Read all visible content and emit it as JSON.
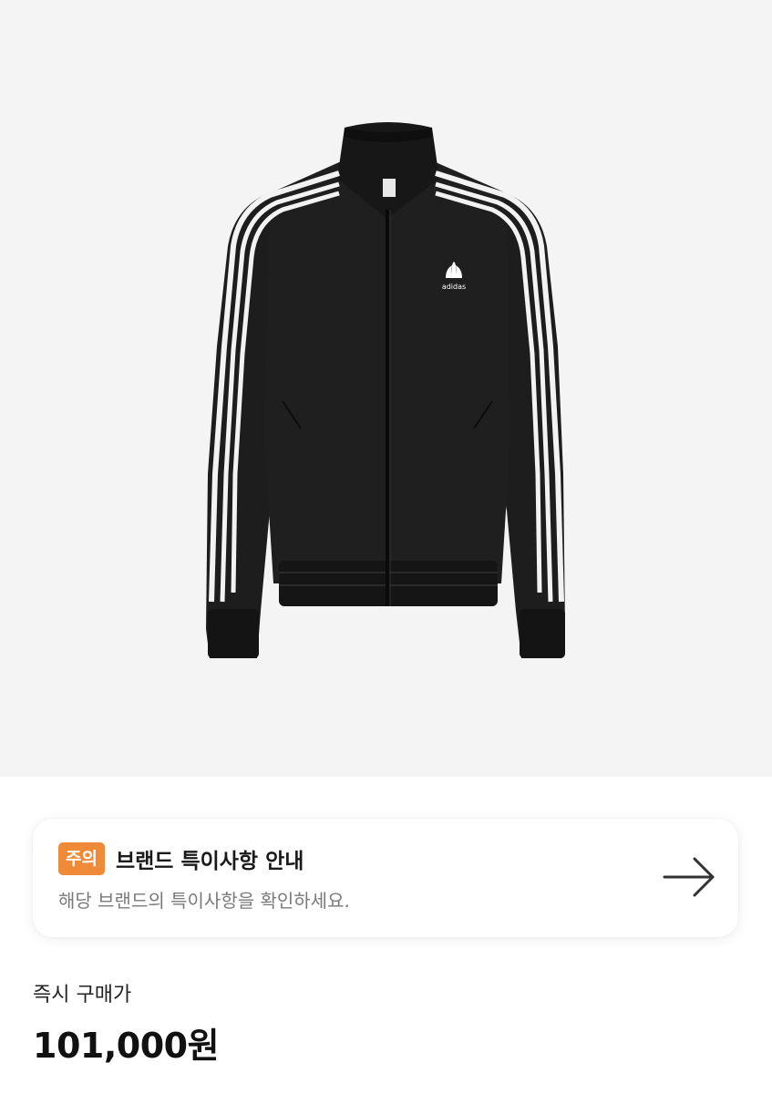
{
  "product": {
    "image_icon": "adidas-track-jacket-image",
    "logo_text": "adidas"
  },
  "notice": {
    "badge": "주의",
    "title": "브랜드 특이사항 안내",
    "subtitle": "해당 브랜드의 특이사항을 확인하세요.",
    "arrow_icon": "arrow-right-icon",
    "badge_color": "#ef8a38"
  },
  "price": {
    "label": "즉시 구매가",
    "value": "101,000원"
  }
}
